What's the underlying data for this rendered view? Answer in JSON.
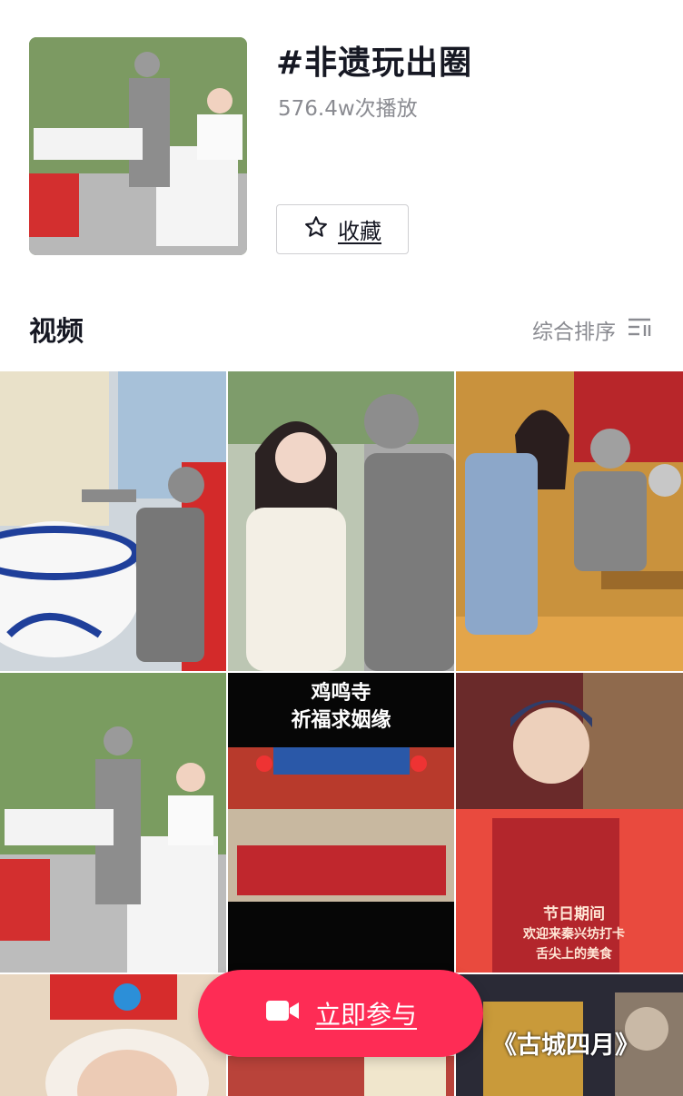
{
  "topic": {
    "title": "#非遗玩出圈",
    "plays": "576.4w次播放",
    "favorite_label": "收藏"
  },
  "videos_section": {
    "title": "视频",
    "sort_label": "综合排序"
  },
  "tiles": [
    {
      "id": "noodle-bowl-performer"
    },
    {
      "id": "woman-and-statue-performer"
    },
    {
      "id": "craft-demonstration"
    },
    {
      "id": "noodle-stunt-garden"
    },
    {
      "id": "temple-group",
      "overlay_line1": "鸡鸣寺",
      "overlay_line2": "祈福求姻缘"
    },
    {
      "id": "apron-vendor-selfie",
      "apron_lines": [
        "节日期间",
        "欢迎来秦兴坊打卡",
        "舌尖上的美食"
      ]
    },
    {
      "id": "santa-hat-person"
    },
    {
      "id": "street-poster"
    },
    {
      "id": "movie-poster",
      "caption": "《古城四月》"
    }
  ],
  "cta": {
    "label": "立即参与",
    "icon": "video-camera-icon"
  },
  "colors": {
    "accent": "#fe2c55",
    "text": "#161823",
    "muted": "#8a8b91"
  }
}
